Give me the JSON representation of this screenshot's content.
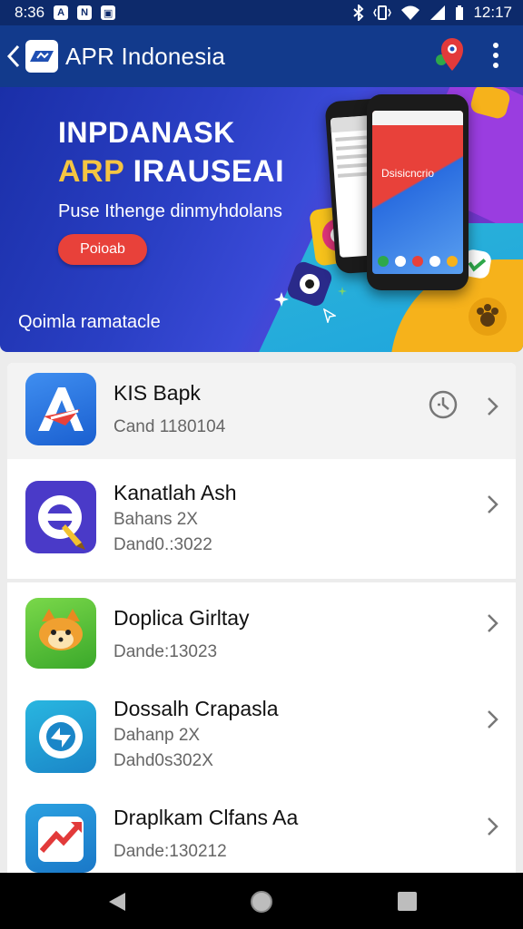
{
  "status_bar": {
    "time": "8:36",
    "clock": "12:17"
  },
  "app_bar": {
    "title": "APR Indonesia"
  },
  "banner": {
    "headline": "INPDANASK",
    "subheadline_prefix": "ARP",
    "subheadline_rest": " IRAUSEAI",
    "tagline": "Puse Ithenge dinmyhdolans",
    "button_label": "Poioab",
    "footer_text": "Qoimla ramatacle",
    "phone_screen_label": "Dsisicncrio"
  },
  "list": {
    "items": [
      {
        "title": "KIS Bapk",
        "lines": [
          "Cand 1180104"
        ],
        "has_timer": true,
        "icon": "apr-a-logo-icon"
      },
      {
        "title": "Kanatlah Ash",
        "lines": [
          "Bahans 2X",
          "Dand0.:3022"
        ],
        "has_timer": false,
        "icon": "e-pen-app-icon"
      },
      {
        "title": "Doplica Girltay",
        "lines": [
          "Dande:13023"
        ],
        "has_timer": false,
        "icon": "fox-mascot-icon"
      },
      {
        "title": "Dossalh Crapasla",
        "lines": [
          "Dahanp 2X",
          "Dahd0s302X"
        ],
        "has_timer": false,
        "icon": "loop-arrow-app-icon"
      },
      {
        "title": "Draplkam Clfans Aa",
        "lines": [
          "Dande:130212"
        ],
        "has_timer": false,
        "icon": "red-arrow-app-icon"
      }
    ]
  },
  "colors": {
    "status_bar": "#0d2a6b",
    "app_bar": "#123a8c",
    "banner_button": "#e8413a",
    "accent_yellow": "#f5c542"
  }
}
